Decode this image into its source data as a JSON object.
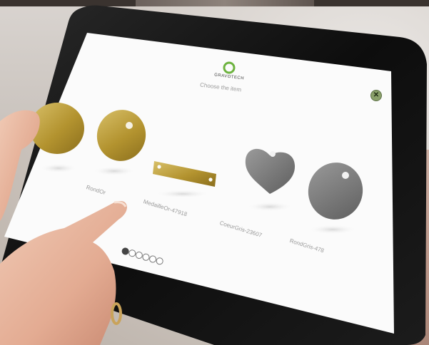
{
  "brand": {
    "logo_text": "GRAVOTECH",
    "logo_color": "#6db33f"
  },
  "header": {
    "subtitle": "Choose the item"
  },
  "close_icon": "close-icon",
  "items": [
    {
      "label": "RondOr",
      "color": "#b99a3a"
    },
    {
      "label": "MedailleOr-47918",
      "color": "#c7a43e"
    },
    {
      "label": "CoeurGris-23607",
      "color": "#7d7d7d"
    },
    {
      "label": "RondGris-478",
      "color": "#6f6f6f"
    }
  ],
  "pagination": {
    "count": 6,
    "active_index": 0
  },
  "colors": {
    "bezel": "#121212",
    "screen": "#fbfbfb",
    "gold": "#b99a3a",
    "grey": "#767676"
  }
}
